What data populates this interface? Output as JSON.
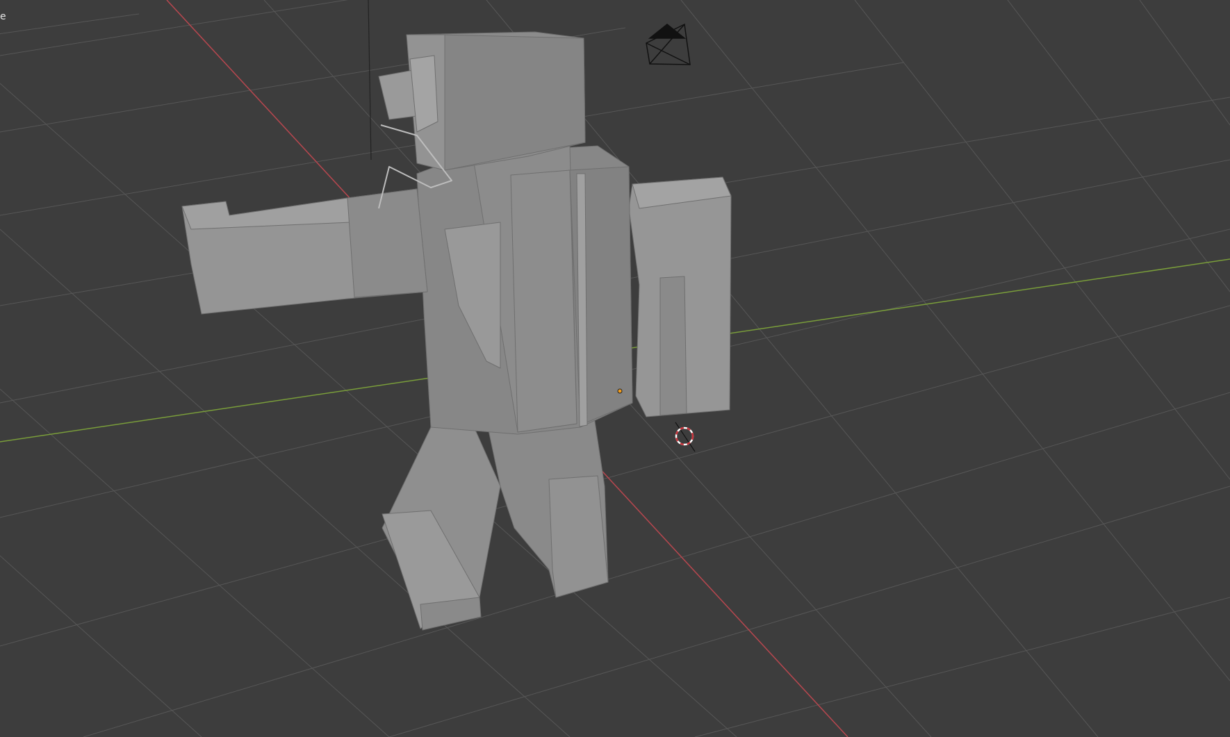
{
  "viewport": {
    "name": "3D Viewport",
    "corner_label": "e",
    "background_color": "#3d3d3d",
    "grid_color": "#555555",
    "x_axis_color": "#b8474f",
    "y_axis_color": "#7a9e3a",
    "z_axis_color": "#222222",
    "mesh_color": "#8e8e8e",
    "origin_color": "#f29c1b",
    "cursor_color": "#c8323a"
  },
  "objects": {
    "mesh": {
      "label": "character-mesh",
      "icon": "block-character"
    },
    "camera": {
      "icon": "camera-icon"
    },
    "cursor": {
      "icon": "3d-cursor-icon"
    },
    "origin": {
      "icon": "object-origin-dot"
    }
  }
}
